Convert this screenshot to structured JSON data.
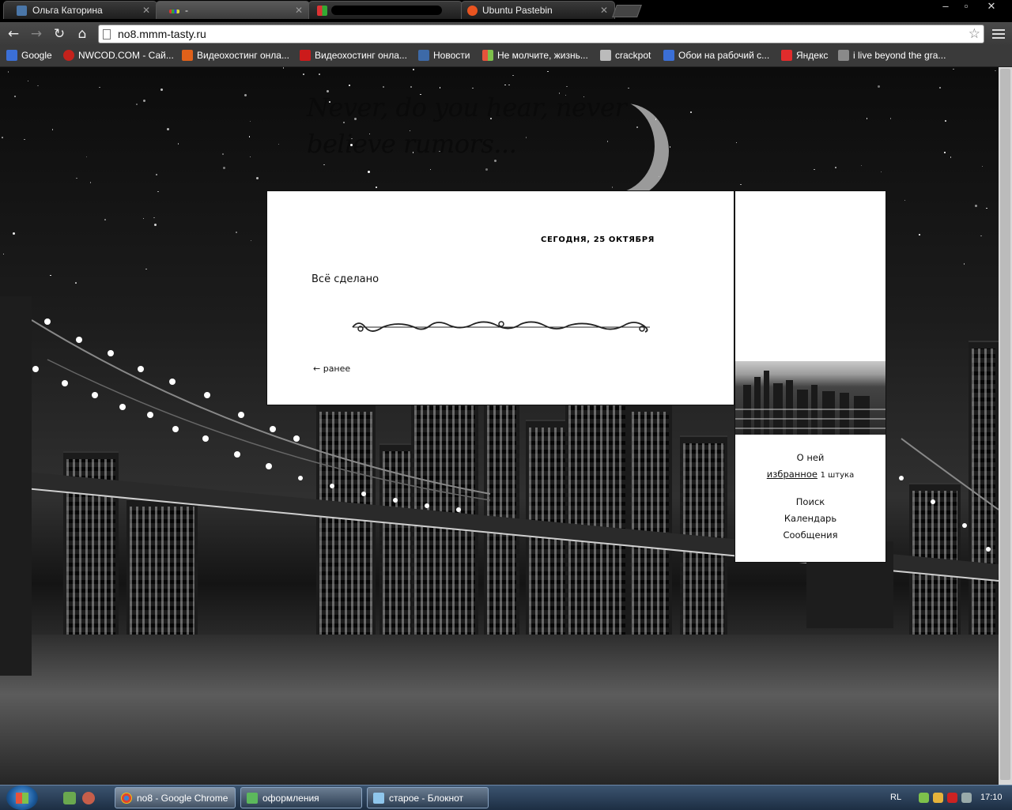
{
  "browser": {
    "tabs": [
      {
        "label": "Ольга Каторина",
        "icon": "vk-icon",
        "active": false
      },
      {
        "label": "-",
        "icon": "site-favicon-icon",
        "active": true
      },
      {
        "label": "",
        "icon": "site-favicon-icon",
        "active": false
      },
      {
        "label": "Ubuntu Pastebin",
        "icon": "ubuntu-icon",
        "active": false
      }
    ],
    "url": "no8.mmm-tasty.ru",
    "window_controls": {
      "minimize": "–",
      "maximize": "▫",
      "close": "✕"
    }
  },
  "bookmarks": [
    {
      "label": "Google",
      "icon": "google-icon",
      "color": "#3b6fd6"
    },
    {
      "label": "NWCOD.COM - Сай...",
      "icon": "nw-icon",
      "color": "#c3221c"
    },
    {
      "label": "Видеохостинг онла...",
      "icon": "f-icon",
      "color": "#e0611a"
    },
    {
      "label": "Видеохостинг онла...",
      "icon": "youtube-icon",
      "color": "#cc1b1b"
    },
    {
      "label": "Новости",
      "icon": "news-icon",
      "color": "#3d6aa8"
    },
    {
      "label": "Не молчите, жизнь...",
      "icon": "windows-icon",
      "color": "#f28b1d"
    },
    {
      "label": "crackpot",
      "icon": "v-icon",
      "color": "#bbbbbb"
    },
    {
      "label": "Обои на рабочий с...",
      "icon": "wallpaper-icon",
      "color": "#3b6fd6"
    },
    {
      "label": "Яндекс",
      "icon": "yandex-icon",
      "color": "#e12c2c"
    },
    {
      "label": "i live beyond the gra...",
      "icon": "photo-icon",
      "color": "#8a8a8a"
    }
  ],
  "page": {
    "tagline": "Never, do you hear, never believe rumors...",
    "post": {
      "date": "СЕГОДНЯ, 25 ОКТЯБРЯ",
      "text": "Всё сделано",
      "earlier_link": "← ранее"
    },
    "sidebar": {
      "about": "О ней",
      "favorites_link": "избранное",
      "favorites_count": "1 штука",
      "search": "Поиск",
      "calendar": "Календарь",
      "messages": "Сообщения"
    }
  },
  "taskbar": {
    "tasks": [
      {
        "label": "no8 - Google Chrome",
        "icon": "chrome-icon",
        "active": true
      },
      {
        "label": "оформления",
        "icon": "folder-icon",
        "active": false
      },
      {
        "label": "старое - Блокнот",
        "icon": "notepad-icon",
        "active": false
      }
    ],
    "language": "RL",
    "clock": "17:10"
  }
}
